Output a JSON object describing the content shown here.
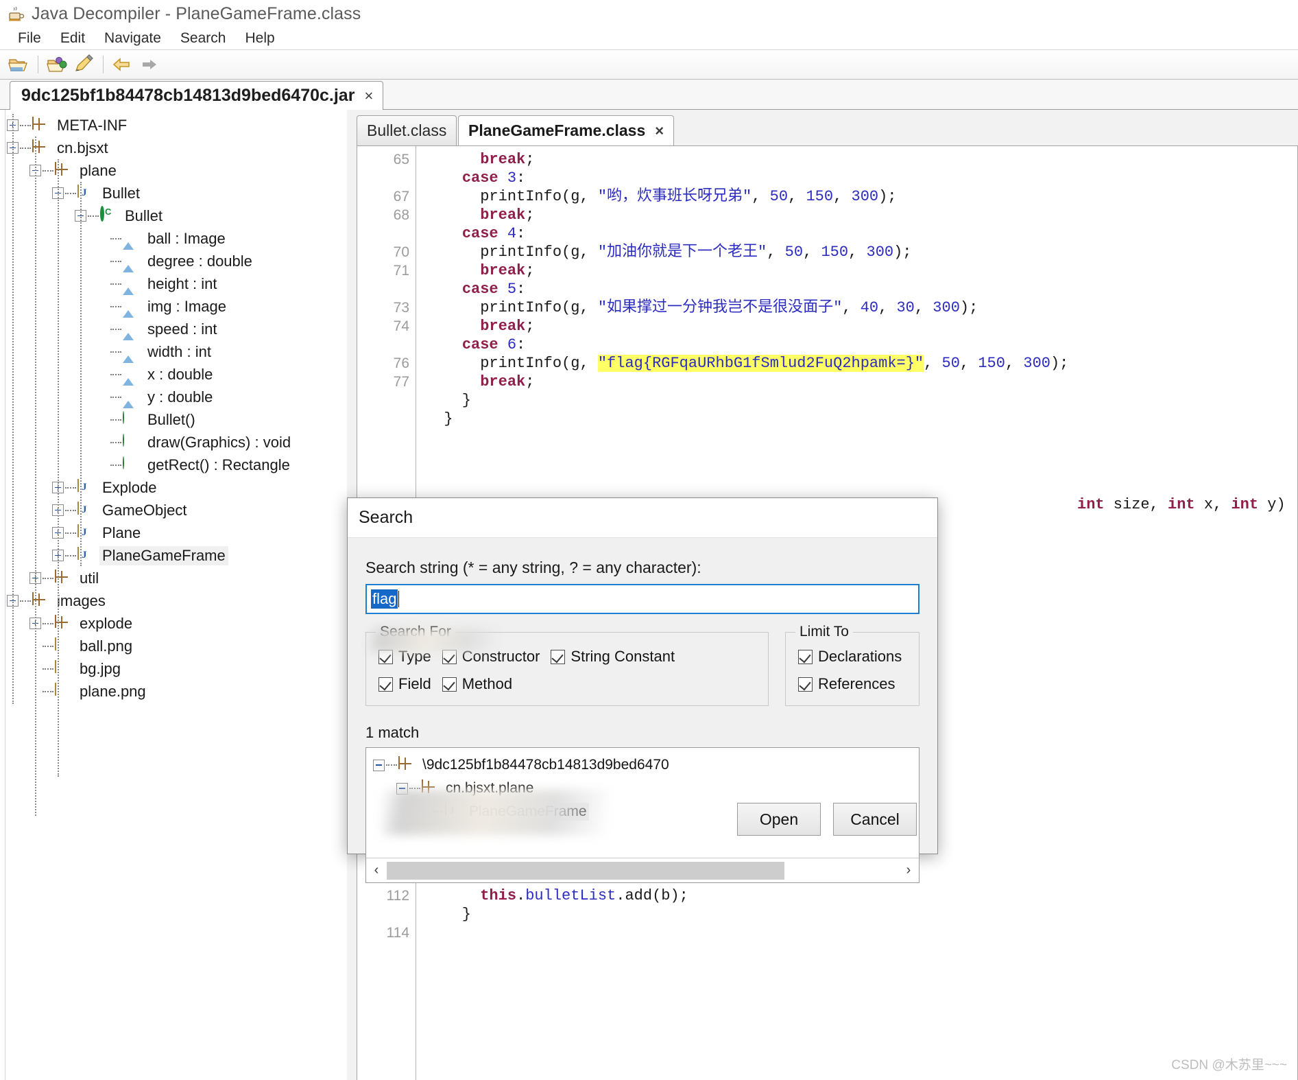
{
  "window": {
    "title": "Java Decompiler - PlaneGameFrame.class",
    "app_icon": "coffee-cup-icon"
  },
  "menubar": {
    "items": [
      "File",
      "Edit",
      "Navigate",
      "Search",
      "Help"
    ]
  },
  "toolbar": {
    "buttons": [
      "open-folder-icon",
      "open-package-icon",
      "save-icon",
      "back-arrow-icon",
      "forward-arrow-icon"
    ]
  },
  "jar_tab": {
    "label": "9dc125bf1b84478cb14813d9bed6470c.jar",
    "close": "×"
  },
  "tree": {
    "nodes": [
      {
        "label": "META-INF",
        "indent": 0,
        "toggle": "plus",
        "icon": "package-icon"
      },
      {
        "label": "cn.bjsxt",
        "indent": 0,
        "toggle": "minus",
        "icon": "package-icon"
      },
      {
        "label": "plane",
        "indent": 1,
        "toggle": "minus",
        "icon": "package-icon"
      },
      {
        "label": "Bullet",
        "indent": 2,
        "toggle": "minus",
        "icon": "java-file-icon"
      },
      {
        "label": "Bullet",
        "indent": 3,
        "toggle": "minus",
        "icon": "class-icon"
      },
      {
        "label": "ball : Image",
        "indent": 4,
        "toggle": "none",
        "icon": "field-icon"
      },
      {
        "label": "degree : double",
        "indent": 4,
        "toggle": "none",
        "icon": "field-icon"
      },
      {
        "label": "height : int",
        "indent": 4,
        "toggle": "none",
        "icon": "field-icon"
      },
      {
        "label": "img : Image",
        "indent": 4,
        "toggle": "none",
        "icon": "field-icon"
      },
      {
        "label": "speed : int",
        "indent": 4,
        "toggle": "none",
        "icon": "field-icon"
      },
      {
        "label": "width : int",
        "indent": 4,
        "toggle": "none",
        "icon": "field-icon"
      },
      {
        "label": "x : double",
        "indent": 4,
        "toggle": "none",
        "icon": "field-icon"
      },
      {
        "label": "y : double",
        "indent": 4,
        "toggle": "none",
        "icon": "field-icon"
      },
      {
        "label": "Bullet()",
        "indent": 4,
        "toggle": "none",
        "icon": "method-icon"
      },
      {
        "label": "draw(Graphics) : void",
        "indent": 4,
        "toggle": "none",
        "icon": "method-icon"
      },
      {
        "label": "getRect() : Rectangle",
        "indent": 4,
        "toggle": "none",
        "icon": "method-icon"
      },
      {
        "label": "Explode",
        "indent": 2,
        "toggle": "plus",
        "icon": "java-file-icon"
      },
      {
        "label": "GameObject",
        "indent": 2,
        "toggle": "plus",
        "icon": "java-file-icon"
      },
      {
        "label": "Plane",
        "indent": 2,
        "toggle": "plus",
        "icon": "java-file-icon"
      },
      {
        "label": "PlaneGameFrame",
        "indent": 2,
        "toggle": "plus",
        "icon": "java-file-icon",
        "selected": true
      },
      {
        "label": "util",
        "indent": 1,
        "toggle": "plus",
        "icon": "package-icon"
      },
      {
        "label": "images",
        "indent": 0,
        "toggle": "minus",
        "icon": "package-icon"
      },
      {
        "label": "explode",
        "indent": 1,
        "toggle": "plus",
        "icon": "package-icon"
      },
      {
        "label": "ball.png",
        "indent": 1,
        "toggle": "none",
        "icon": "file-icon"
      },
      {
        "label": "bg.jpg",
        "indent": 1,
        "toggle": "none",
        "icon": "file-icon"
      },
      {
        "label": "plane.png",
        "indent": 1,
        "toggle": "none",
        "icon": "file-icon"
      }
    ]
  },
  "editor": {
    "tabs": [
      {
        "label": "Bullet.class",
        "active": false,
        "closable": false
      },
      {
        "label": "PlaneGameFrame.class",
        "active": true,
        "closable": true,
        "close": "×"
      }
    ],
    "lines": [
      {
        "num": "65",
        "segments": [
          {
            "t": "      ",
            "c": "pl"
          },
          {
            "t": "break",
            "c": "kw"
          },
          {
            "t": ";",
            "c": "pl"
          }
        ]
      },
      {
        "num": "",
        "segments": [
          {
            "t": "    ",
            "c": "pl"
          },
          {
            "t": "case",
            "c": "kw"
          },
          {
            "t": " ",
            "c": "pl"
          },
          {
            "t": "3",
            "c": "num"
          },
          {
            "t": ":",
            "c": "pl"
          }
        ]
      },
      {
        "num": "67",
        "segments": [
          {
            "t": "      ",
            "c": "pl"
          },
          {
            "t": "printInfo",
            "c": "fn"
          },
          {
            "t": "(g, ",
            "c": "pl"
          },
          {
            "t": "\"哟，炊事班长呀兄弟\"",
            "c": "str"
          },
          {
            "t": ", ",
            "c": "pl"
          },
          {
            "t": "50",
            "c": "num"
          },
          {
            "t": ", ",
            "c": "pl"
          },
          {
            "t": "150",
            "c": "num"
          },
          {
            "t": ", ",
            "c": "pl"
          },
          {
            "t": "300",
            "c": "num"
          },
          {
            "t": ");",
            "c": "pl"
          }
        ]
      },
      {
        "num": "68",
        "segments": [
          {
            "t": "      ",
            "c": "pl"
          },
          {
            "t": "break",
            "c": "kw"
          },
          {
            "t": ";",
            "c": "pl"
          }
        ]
      },
      {
        "num": "",
        "segments": [
          {
            "t": "    ",
            "c": "pl"
          },
          {
            "t": "case",
            "c": "kw"
          },
          {
            "t": " ",
            "c": "pl"
          },
          {
            "t": "4",
            "c": "num"
          },
          {
            "t": ":",
            "c": "pl"
          }
        ]
      },
      {
        "num": "70",
        "segments": [
          {
            "t": "      ",
            "c": "pl"
          },
          {
            "t": "printInfo",
            "c": "fn"
          },
          {
            "t": "(g, ",
            "c": "pl"
          },
          {
            "t": "\"加油你就是下一个老王\"",
            "c": "str"
          },
          {
            "t": ", ",
            "c": "pl"
          },
          {
            "t": "50",
            "c": "num"
          },
          {
            "t": ", ",
            "c": "pl"
          },
          {
            "t": "150",
            "c": "num"
          },
          {
            "t": ", ",
            "c": "pl"
          },
          {
            "t": "300",
            "c": "num"
          },
          {
            "t": ");",
            "c": "pl"
          }
        ]
      },
      {
        "num": "71",
        "segments": [
          {
            "t": "      ",
            "c": "pl"
          },
          {
            "t": "break",
            "c": "kw"
          },
          {
            "t": ";",
            "c": "pl"
          }
        ]
      },
      {
        "num": "",
        "segments": [
          {
            "t": "    ",
            "c": "pl"
          },
          {
            "t": "case",
            "c": "kw"
          },
          {
            "t": " ",
            "c": "pl"
          },
          {
            "t": "5",
            "c": "num"
          },
          {
            "t": ":",
            "c": "pl"
          }
        ]
      },
      {
        "num": "73",
        "segments": [
          {
            "t": "      ",
            "c": "pl"
          },
          {
            "t": "printInfo",
            "c": "fn"
          },
          {
            "t": "(g, ",
            "c": "pl"
          },
          {
            "t": "\"如果撑过一分钟我岂不是很没面子\"",
            "c": "str"
          },
          {
            "t": ", ",
            "c": "pl"
          },
          {
            "t": "40",
            "c": "num"
          },
          {
            "t": ", ",
            "c": "pl"
          },
          {
            "t": "30",
            "c": "num"
          },
          {
            "t": ", ",
            "c": "pl"
          },
          {
            "t": "300",
            "c": "num"
          },
          {
            "t": ");",
            "c": "pl"
          }
        ]
      },
      {
        "num": "74",
        "segments": [
          {
            "t": "      ",
            "c": "pl"
          },
          {
            "t": "break",
            "c": "kw"
          },
          {
            "t": ";",
            "c": "pl"
          }
        ]
      },
      {
        "num": "",
        "segments": [
          {
            "t": "    ",
            "c": "pl"
          },
          {
            "t": "case",
            "c": "kw"
          },
          {
            "t": " ",
            "c": "pl"
          },
          {
            "t": "6",
            "c": "num"
          },
          {
            "t": ":",
            "c": "pl"
          }
        ]
      },
      {
        "num": "76",
        "segments": [
          {
            "t": "      ",
            "c": "pl"
          },
          {
            "t": "printInfo",
            "c": "fn"
          },
          {
            "t": "(g, ",
            "c": "pl"
          },
          {
            "t": "\"flag{RGFqaURhbG1fSmlud2FuQ2hpamk=}\"",
            "c": "str hl"
          },
          {
            "t": ", ",
            "c": "pl"
          },
          {
            "t": "50",
            "c": "num"
          },
          {
            "t": ", ",
            "c": "pl"
          },
          {
            "t": "150",
            "c": "num"
          },
          {
            "t": ", ",
            "c": "pl"
          },
          {
            "t": "300",
            "c": "num"
          },
          {
            "t": ");",
            "c": "pl"
          }
        ]
      },
      {
        "num": "77",
        "segments": [
          {
            "t": "      ",
            "c": "pl"
          },
          {
            "t": "break",
            "c": "kw"
          },
          {
            "t": ";",
            "c": "pl"
          }
        ]
      },
      {
        "num": "",
        "segments": [
          {
            "t": "    }",
            "c": "pl"
          }
        ]
      },
      {
        "num": "",
        "segments": [
          {
            "t": "  }",
            "c": "pl"
          }
        ]
      }
    ],
    "behind_dialog_line": {
      "segments": [
        {
          "t": "int",
          "c": "kw"
        },
        {
          "t": " size, ",
          "c": "pl"
        },
        {
          "t": "int",
          "c": "kw"
        },
        {
          "t": " x, ",
          "c": "pl"
        },
        {
          "t": "int",
          "c": "kw"
        },
        {
          "t": " y)",
          "c": "pl"
        }
      ]
    },
    "bottom_lines": [
      {
        "num": "112",
        "segments": [
          {
            "t": "      ",
            "c": "pl"
          },
          {
            "t": "this",
            "c": "kw"
          },
          {
            "t": ".",
            "c": "pl"
          },
          {
            "t": "bulletList",
            "c": "fld"
          },
          {
            "t": ".add(b);",
            "c": "pl"
          }
        ]
      },
      {
        "num": "",
        "segments": [
          {
            "t": "    }",
            "c": "pl"
          }
        ]
      },
      {
        "num": "114",
        "segments": [
          {
            "t": "  ",
            "c": "pl"
          }
        ]
      }
    ]
  },
  "dialog": {
    "title": "Search",
    "search_label": "Search string (* = any string, ? = any character):",
    "search_value": "flag",
    "search_for": {
      "legend": "Search For",
      "row1": [
        {
          "label": "Type",
          "checked": true
        },
        {
          "label": "Constructor",
          "checked": true
        },
        {
          "label": "String Constant",
          "checked": true
        }
      ],
      "row2": [
        {
          "label": "Field",
          "checked": true
        },
        {
          "label": "Method",
          "checked": true
        }
      ]
    },
    "limit_to": {
      "legend": "Limit To",
      "items": [
        {
          "label": "Declarations",
          "checked": true
        },
        {
          "label": "References",
          "checked": true
        }
      ]
    },
    "match_text": "1 match",
    "results": [
      {
        "label": "\\9dc125bf1b84478cb14813d9bed6470",
        "indent": 0,
        "toggle": "minus",
        "icon": "jar-icon",
        "redacted": true
      },
      {
        "label": "cn.bjsxt.plane",
        "indent": 1,
        "toggle": "minus",
        "icon": "package-icon"
      },
      {
        "label": "PlaneGameFrame",
        "indent": 2,
        "toggle": "none",
        "icon": "java-file-icon",
        "selected": true
      }
    ],
    "scroll": {
      "left_arrow": "‹",
      "right_arrow": "›"
    },
    "buttons": {
      "open": "Open",
      "cancel": "Cancel"
    }
  },
  "watermark": {
    "text": "CSDN @木苏里~~~"
  }
}
